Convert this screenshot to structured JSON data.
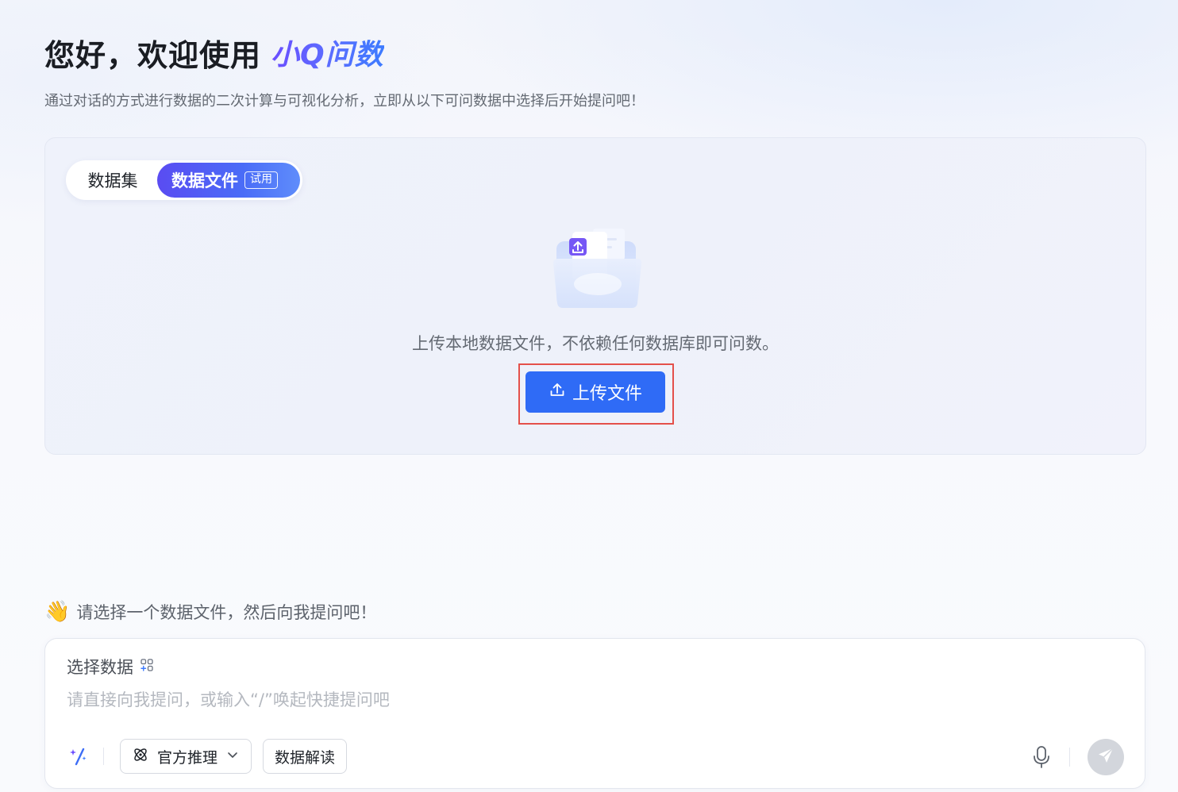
{
  "header": {
    "greeting": "您好，欢迎使用",
    "brand": "小Q问数",
    "subtitle": "通过对话的方式进行数据的二次计算与可视化分析，立即从以下可问数据中选择后开始提问吧！"
  },
  "source_tabs": {
    "items": [
      {
        "label": "数据集",
        "active": false
      },
      {
        "label": "数据文件",
        "active": true,
        "badge": "试用"
      }
    ]
  },
  "upload": {
    "description": "上传本地数据文件，不依赖任何数据库即可问数。",
    "button_label": "上传文件"
  },
  "hint": {
    "emoji": "👋",
    "text": "请选择一个数据文件，然后向我提问吧！"
  },
  "composer": {
    "select_data_label": "选择数据",
    "input_value": "",
    "input_placeholder": "请直接向我提问，或输入“/”唤起快捷提问吧",
    "model_select_label": "官方推理",
    "data_interpret_label": "数据解读"
  },
  "colors": {
    "primary": "#2f6bf6",
    "tab_gradient_start": "#5a4cf2",
    "tab_gradient_end": "#5f8dfb",
    "highlight_frame": "#e4504a",
    "send_disabled": "#d3d6dc"
  },
  "icons": {
    "upload": "upload-icon",
    "folder": "upload-folder-illustration",
    "grid": "grid-icon",
    "magic": "magic-wand-icon",
    "model": "model-icon",
    "chevron": "chevron-down-icon",
    "mic": "microphone-icon",
    "send": "send-icon"
  }
}
